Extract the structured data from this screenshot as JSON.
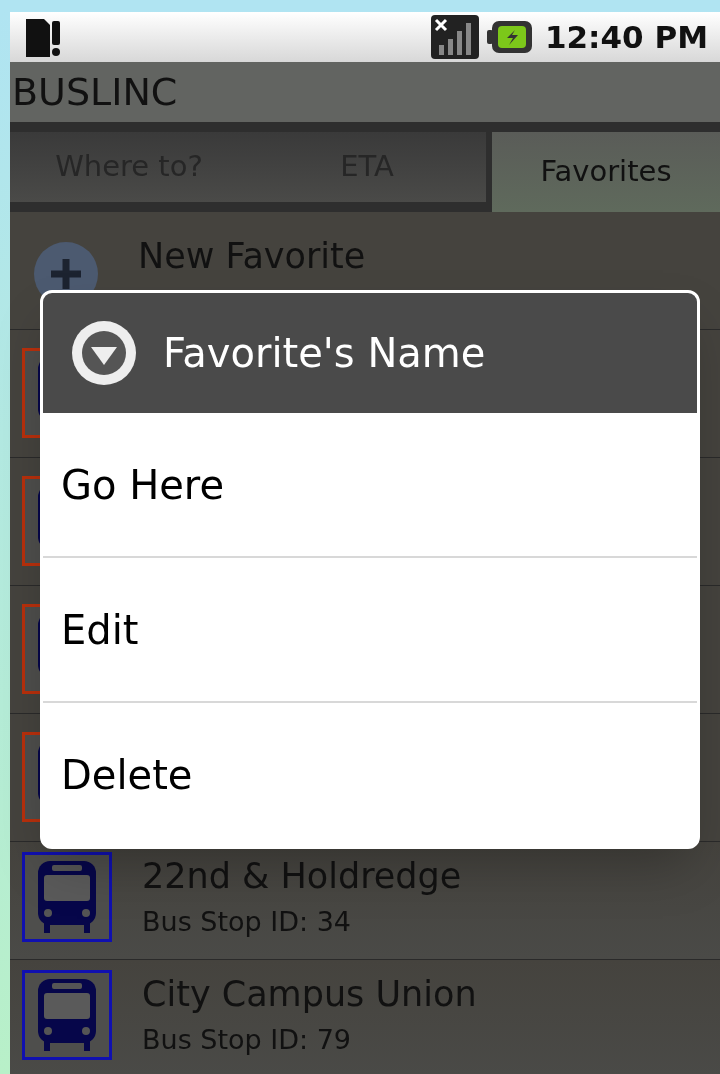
{
  "status_bar": {
    "time": "12:40 PM"
  },
  "app_title": "BUSLINC",
  "tabs": [
    {
      "label": "Where to?",
      "selected": false
    },
    {
      "label": "ETA",
      "selected": false
    },
    {
      "label": "Favorites",
      "selected": true
    }
  ],
  "new_favorite": {
    "label": "New Favorite"
  },
  "favorites": [
    {
      "color": "#b8300c"
    },
    {
      "color": "#b8300c"
    },
    {
      "color": "#b8300c"
    },
    {
      "color": "#b8300c"
    },
    {
      "name": "22nd & Holdredge",
      "stop_id": "Bus Stop ID: 34",
      "color": "#1010b0"
    },
    {
      "name": "City Campus Union",
      "stop_id": "Bus Stop ID: 79",
      "color": "#1010b0"
    }
  ],
  "dialog": {
    "title": "Favorite's Name",
    "items": [
      "Go Here",
      "Edit",
      "Delete"
    ]
  }
}
